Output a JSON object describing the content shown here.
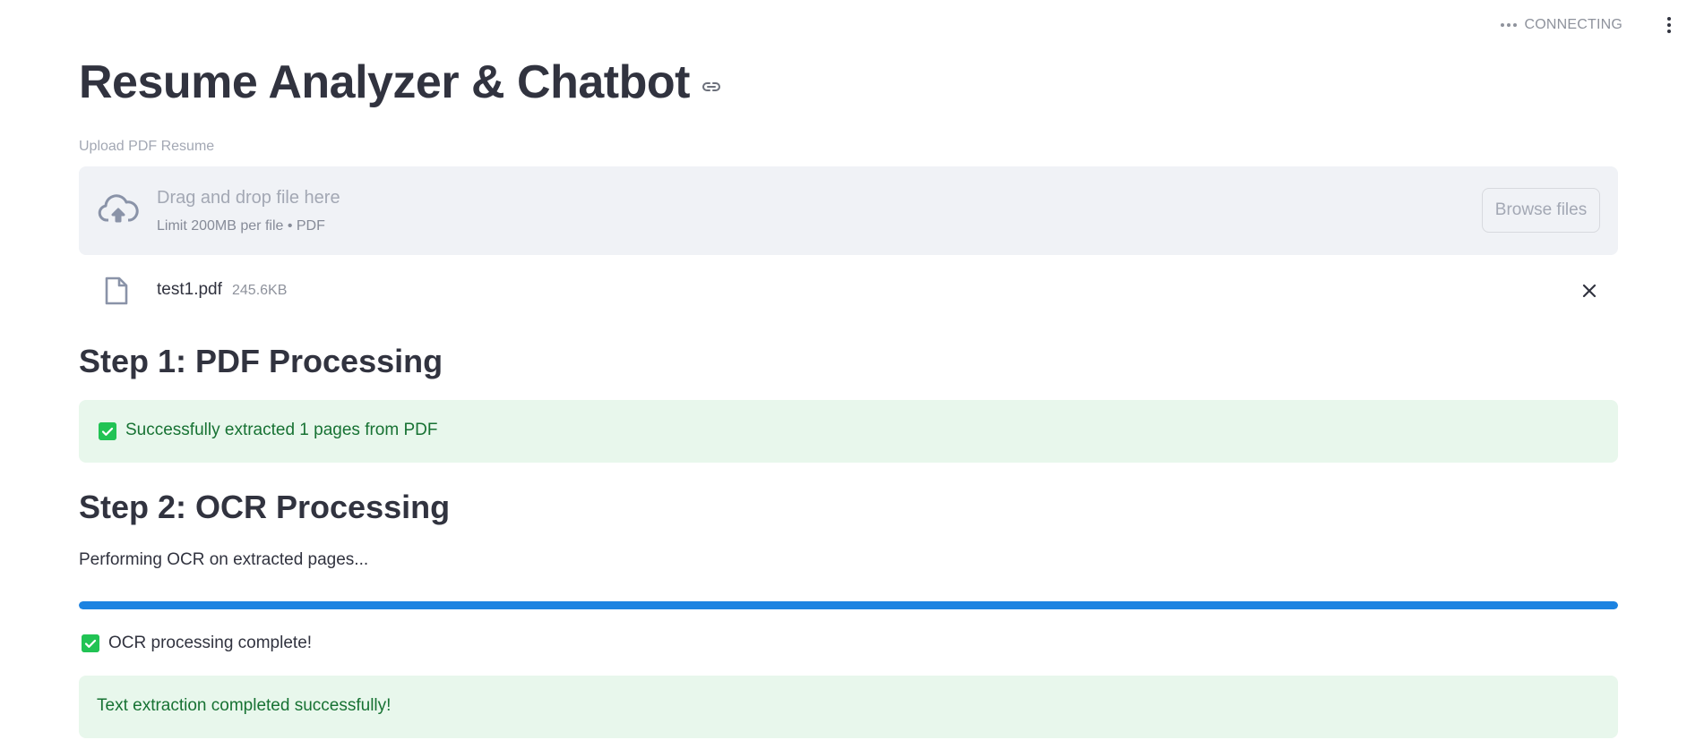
{
  "header": {
    "status_text": "CONNECTING",
    "status_icon": "dots-icon",
    "menu_icon": "kebab-menu-icon"
  },
  "page": {
    "title": "Resume Analyzer & Chatbot",
    "title_anchor_icon": "link-icon"
  },
  "uploader": {
    "label": "Upload PDF Resume",
    "drop_title": "Drag and drop file here",
    "drop_subtitle": "Limit 200MB per file • PDF",
    "browse_label": "Browse files",
    "icon": "cloud-upload-icon"
  },
  "uploaded_file": {
    "name": "test1.pdf",
    "size": "245.6KB",
    "icon": "file-icon",
    "remove_icon": "close-icon"
  },
  "step1": {
    "heading": "Step 1: PDF Processing",
    "success_text": "Successfully extracted 1 pages from PDF"
  },
  "step2": {
    "heading": "Step 2: OCR Processing",
    "performing_text": "Performing OCR on extracted pages...",
    "progress_percent": 100,
    "complete_text": "OCR processing complete!",
    "final_success_text": "Text extraction completed successfully!"
  },
  "colors": {
    "accent": "#1c83e1",
    "success_bg": "#e8f7ec",
    "success_text": "#177233",
    "check_green": "#21c354"
  }
}
